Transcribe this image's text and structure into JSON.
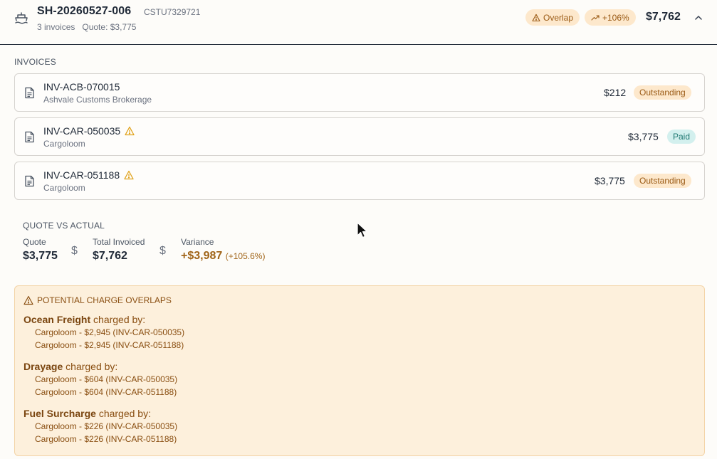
{
  "header": {
    "shipment_id": "SH-20260527-006",
    "container_no": "CSTU7329721",
    "invoice_count": "3 invoices",
    "quote": "Quote: $3,775",
    "badges": {
      "overlap": "Overlap",
      "increase": "+106%"
    },
    "total": "$7,762",
    "icons": {
      "shipment": "ship-icon",
      "toggle": "chevron-up-icon"
    }
  },
  "invoices": {
    "section_label": "INVOICES",
    "items": [
      {
        "number": "INV-ACB-070015",
        "vendor": "Ashvale Customs Brokerage",
        "amount": "$212",
        "status": "Outstanding",
        "warning": false
      },
      {
        "number": "INV-CAR-050035",
        "vendor": "Cargoloom",
        "amount": "$3,775",
        "status": "Paid",
        "warning": true
      },
      {
        "number": "INV-CAR-051188",
        "vendor": "Cargoloom",
        "amount": "$3,775",
        "status": "Outstanding",
        "warning": true
      }
    ]
  },
  "quote_vs_actual": {
    "section_label": "QUOTE VS ACTUAL",
    "quote_label": "Quote",
    "quote_value": "$3,775",
    "invoiced_label": "Total Invoiced",
    "invoiced_value": "$7,762",
    "variance_label": "Variance",
    "variance_value": "+$3,987",
    "variance_pct": "(+105.6%)",
    "separator_symbol": "$"
  },
  "overlaps": {
    "title": "POTENTIAL CHARGE OVERLAPS",
    "charged_by": "charged by:",
    "groups": [
      {
        "charge": "Ocean Freight",
        "lines": [
          "Cargoloom - $2,945 (INV-CAR-050035)",
          "Cargoloom - $2,945 (INV-CAR-051188)"
        ]
      },
      {
        "charge": "Drayage",
        "lines": [
          "Cargoloom - $604 (INV-CAR-050035)",
          "Cargoloom - $604 (INV-CAR-051188)"
        ]
      },
      {
        "charge": "Fuel Surcharge",
        "lines": [
          "Cargoloom - $226 (INV-CAR-050035)",
          "Cargoloom - $226 (INV-CAR-051188)"
        ]
      }
    ]
  },
  "colors": {
    "warning_bg": "#fdf0dc",
    "warning_text": "#8a4f12",
    "paid_bg": "#d3f0ee",
    "outstanding_bg": "#fde8cc",
    "variance": "#a06418"
  }
}
